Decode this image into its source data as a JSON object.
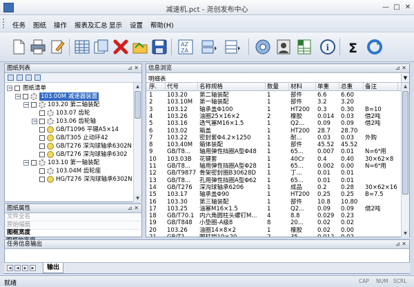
{
  "app": {
    "title": "减速机.pct - 尧创发布中心"
  },
  "menu": [
    "任务",
    "图纸",
    "操作",
    "报表及汇总",
    "显示",
    "设置",
    "帮助(H)"
  ],
  "toolbar": {
    "icons": [
      "new-document-icon",
      "print-icon",
      "edit-document-icon",
      "table-icon",
      "open-catalog-icon",
      "delete-icon",
      "open-folder-icon",
      "save-icon",
      "sort-az-icon",
      "layout-icon",
      "split-view-icon",
      "disc-icon",
      "user-icon",
      "spreadsheet-icon",
      "info-icon",
      "sum-icon",
      "refresh-icon"
    ]
  },
  "tree_panel": {
    "title": "图纸列表",
    "root": "图纸清单",
    "items": [
      {
        "label": "103.00M 减速器装置",
        "level": 1,
        "icon": "gear",
        "expand": "-",
        "selected": true
      },
      {
        "label": "103.20 第二轴装配",
        "level": 2,
        "icon": "gear",
        "expand": "-"
      },
      {
        "label": "103.07 齿轮",
        "level": 3,
        "icon": "gear",
        "expand": ""
      },
      {
        "label": "103.06 齿轮轴",
        "level": 3,
        "icon": "gear",
        "expand": "-"
      },
      {
        "label": "GB/T1096 平键A5×14",
        "level": 3,
        "icon": "bolt",
        "expand": ""
      },
      {
        "label": "GB/T305 止动环42",
        "level": 3,
        "icon": "bolt",
        "expand": ""
      },
      {
        "label": "GB/T276 深沟球轴承6302N",
        "level": 3,
        "icon": "bolt",
        "expand": ""
      },
      {
        "label": "GB/T276 深沟球轴承6302",
        "level": 3,
        "icon": "bolt",
        "expand": ""
      },
      {
        "label": "103.10 第一轴装配",
        "level": 2,
        "icon": "gear",
        "expand": "-"
      },
      {
        "label": "103.04M 齿轮座",
        "level": 3,
        "icon": "gear",
        "expand": ""
      },
      {
        "label": "HG/T276 深沟球轴承6302N",
        "level": 3,
        "icon": "bolt",
        "expand": ""
      }
    ]
  },
  "props_panel": {
    "title": "图纸属性",
    "rows": [
      "文件全名",
      "原始幅面"
    ],
    "desc_title": "图框宽度",
    "desc_text": "图框的宽度"
  },
  "info_panel": {
    "title": "信息浏览",
    "combo_value": "明细表",
    "columns": [
      "序.",
      "代号",
      "名称规格",
      "数量",
      "材料",
      "单重",
      "总重",
      "备注"
    ],
    "rows": [
      [
        "1",
        "103.20",
        "第二轴装配",
        "1",
        "部件",
        "6.6",
        "6.60",
        ""
      ],
      [
        "2",
        "103.10M",
        "第一轴装配",
        "1",
        "部件",
        "3.2",
        "3.20",
        ""
      ],
      [
        "3",
        "103.12",
        "轴承盖Φ100",
        "1",
        "HT200",
        "0.3",
        "0.30",
        "B=10"
      ],
      [
        "4",
        "103.26",
        "油圈25×16×2",
        "2",
        "橡胶",
        "0.014",
        "0.03",
        "借2吨"
      ],
      [
        "5",
        "103.16",
        "透气塞M16×1.5",
        "1",
        "Q2...",
        "0.09",
        "0.09",
        "借2吨"
      ],
      [
        "6",
        "103.02",
        "箱盖",
        "1",
        "HT200",
        "28.7",
        "28.70",
        ""
      ],
      [
        "7",
        "103.22",
        "密封套Φ4.2×1250",
        "1",
        "耐...",
        "0.03",
        "0.03",
        "外购"
      ],
      [
        "8",
        "103.40M",
        "箱体装配",
        "1",
        "部件",
        "45.52",
        "45.52",
        ""
      ],
      [
        "9",
        "GB/T8...",
        "轴用弹性挡圈A型Φ48",
        "1",
        "65...",
        "0.007",
        "0.01",
        "N=6⁴用"
      ],
      [
        "10",
        "103.03B",
        "花键套",
        "1",
        "40Cr",
        "0.4",
        "0.40",
        "30×62×8"
      ],
      [
        "11",
        "GB/T8...",
        "轴用弹性挡圈A型Φ28",
        "1",
        "65...",
        "0.002",
        "0.00",
        "N=6⁴用"
      ],
      [
        "12",
        "GB/T9877",
        "骨架密封圈B30628D",
        "1",
        "丁...",
        "0.01",
        "0.01",
        ""
      ],
      [
        "13",
        "GB/T8...",
        "孔用弹性挡圈A型Φ62",
        "1",
        "65...",
        "0.01",
        "0.01",
        ""
      ],
      [
        "14",
        "GB/T276",
        "深沟球轴承6206",
        "1",
        "成品",
        "0.2",
        "0.28",
        "30×62×16"
      ],
      [
        "15",
        "103.17",
        "轴承盖Φ90",
        "1",
        "HT200",
        "0.25",
        "0.25",
        "B=7.5"
      ],
      [
        "16",
        "103.30",
        "第三轴装配",
        "1",
        "部件",
        "10.8",
        "10.80",
        ""
      ],
      [
        "17",
        "103.25",
        "油塞M16×1.5",
        "1",
        "Q2...",
        "0.09",
        "0.09",
        "借2吨"
      ],
      [
        "18",
        "GB/T70.1",
        "内六角圆柱头螺钉M...",
        "4",
        "8.8",
        "0.029",
        "0.23",
        ""
      ],
      [
        "19",
        "GB/T848",
        "小垫圈-A级8",
        "8",
        "20...",
        "0.02",
        "0.02",
        ""
      ],
      [
        "20",
        "103.26",
        "油圈14×8×2",
        "1",
        "橡胶",
        "0.02",
        "0.00",
        ""
      ],
      [
        "21",
        "GB/T1...",
        "圆柱销10×20",
        "2",
        "35",
        "0.012",
        "0.02",
        ""
      ]
    ]
  },
  "output_panel": {
    "title": "任务信息输出",
    "tab": "输出"
  },
  "status": {
    "text": "就绪",
    "indicators": [
      "CAP",
      "NUM",
      "SCRL"
    ]
  }
}
